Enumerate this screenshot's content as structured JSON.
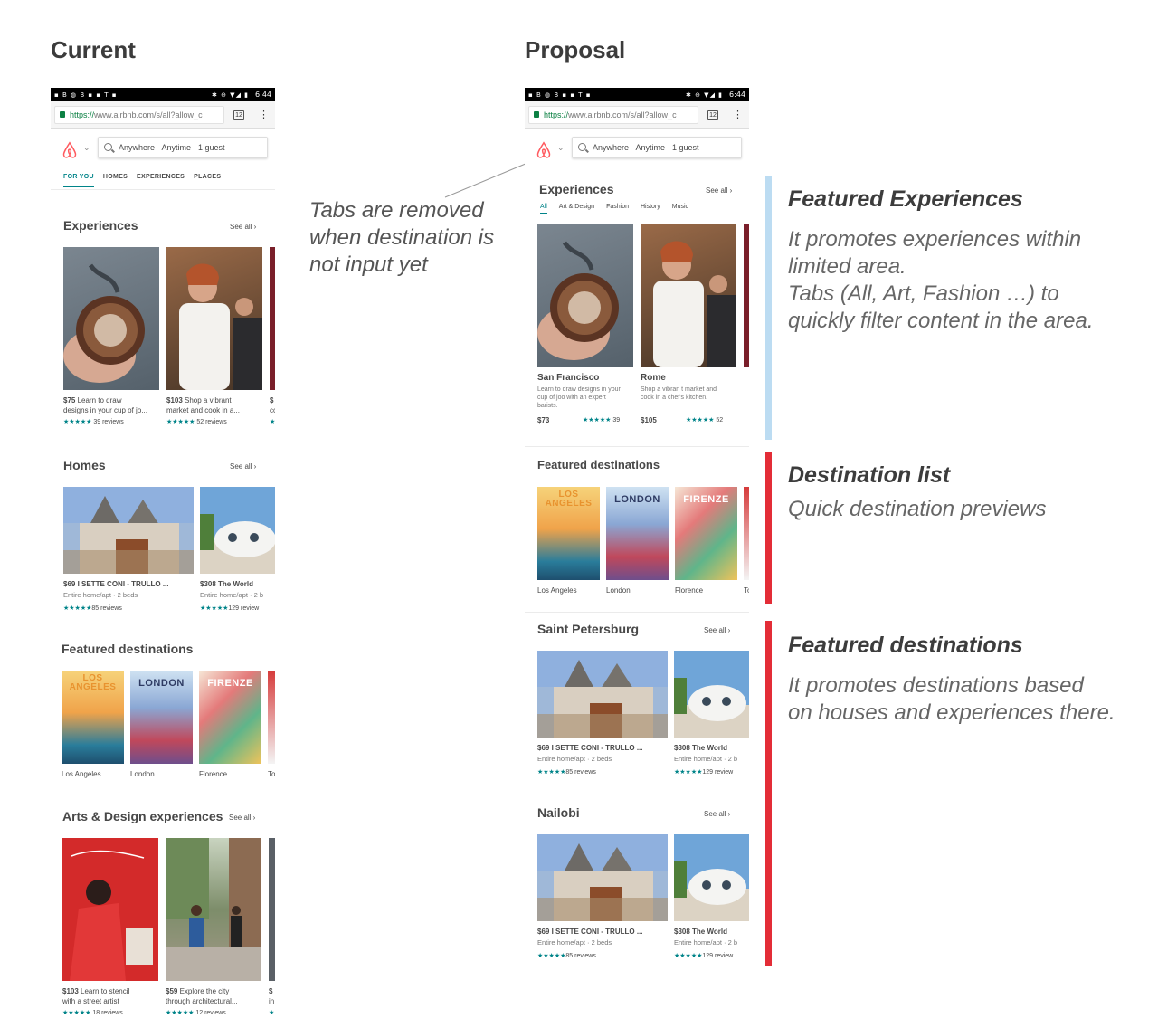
{
  "headings": {
    "current": "Current",
    "proposal": "Proposal"
  },
  "phone": {
    "time": "6:44",
    "status_icons": "▪ B ◍ B ▪ ▪ T ▪",
    "status_right": "✱ ⊖ ▼◢ ▮",
    "url_scheme": "https://",
    "url_rest": "www.airbnb.com/s/all?allow_c",
    "tab_count": "12",
    "menu_icon": "⋮",
    "chevron": "⌄",
    "search_text": "Anywhere · Anytime · 1 guest"
  },
  "current": {
    "tabs": [
      "FOR YOU",
      "HOMES",
      "EXPERIENCES",
      "PLACES"
    ],
    "experiences": {
      "title": "Experiences",
      "see_all": "See all ›",
      "cards": [
        {
          "price": "$75",
          "line1": " Learn to draw",
          "line2": "designs in your cup of jo...",
          "stars": "★★★★★",
          "reviews": "39 reviews"
        },
        {
          "price": "$103",
          "line1": " Shop a vibrant",
          "line2": "market and cook in a...",
          "stars": "★★★★★",
          "reviews": "52 reviews"
        },
        {
          "price": "$",
          "line1": "",
          "line2": "cc",
          "stars": "★",
          "reviews": ""
        }
      ]
    },
    "homes": {
      "title": "Homes",
      "see_all": "See all ›",
      "cards": [
        {
          "price": "$69",
          "name": "I SETTE CONI - TRULLO ...",
          "line2": "Entire home/apt · 2 beds",
          "stars": "★★★★★",
          "reviews": "85 reviews"
        },
        {
          "price": "$308",
          "name": "The World",
          "line2": "Entire home/apt · 2 b",
          "stars": "★★★★★",
          "reviews": "129 review"
        }
      ]
    },
    "destinations": {
      "title": "Featured destinations",
      "items": [
        "Los Angeles",
        "London",
        "Florence",
        "To"
      ]
    },
    "arts": {
      "title": "Arts & Design experiences",
      "see_all": "See all ›",
      "cards": [
        {
          "price": "$103",
          "line1": " Learn to stencil",
          "line2": "with a street artist",
          "stars": "★★★★★",
          "reviews": "18 reviews"
        },
        {
          "price": "$59",
          "line1": " Explore the city",
          "line2": "through architectural...",
          "stars": "★★★★★",
          "reviews": "12 reviews"
        },
        {
          "price": "$",
          "line1": "",
          "line2": "in",
          "stars": "★",
          "reviews": ""
        }
      ]
    }
  },
  "proposal": {
    "experiences": {
      "title": "Experiences",
      "see_all": "See all ›",
      "tabs": [
        "All",
        "Art & Design",
        "Fashion",
        "History",
        "Music"
      ],
      "cards": [
        {
          "city": "San Francisco",
          "desc1": "Learn to draw designs in your",
          "desc2": "cup of joo with an expert",
          "desc3": "barists.",
          "price": "$73",
          "stars": "★★★★★",
          "reviews": "39"
        },
        {
          "city": "Rome",
          "desc1": "Shop a vibran t market and",
          "desc2": "cook in a chef's kitchen.",
          "desc3": "",
          "price": "$105",
          "stars": "★★★★★",
          "reviews": "52"
        }
      ]
    },
    "destinations": {
      "title": "Featured destinations",
      "items": [
        "Los Angeles",
        "London",
        "Florence",
        "To"
      ]
    },
    "city1": {
      "title": "Saint Petersburg",
      "see_all": "See all ›",
      "cards": [
        {
          "price": "$69",
          "name": "I SETTE CONI - TRULLO ...",
          "line2": "Entire home/apt · 2 beds",
          "stars": "★★★★★",
          "reviews": "85 reviews"
        },
        {
          "price": "$308",
          "name": "The World",
          "line2": "Entire home/apt · 2 b",
          "stars": "★★★★★",
          "reviews": "129 review"
        }
      ]
    },
    "city2": {
      "title": "Nailobi",
      "see_all": "See all ›",
      "cards": [
        {
          "price": "$69",
          "name": "I SETTE CONI - TRULLO ...",
          "line2": "Entire home/apt · 2 beds",
          "stars": "★★★★★",
          "reviews": "85 reviews"
        },
        {
          "price": "$308",
          "name": "The World",
          "line2": "Entire home/apt · 2 b",
          "stars": "★★★★★",
          "reviews": "129 review"
        }
      ]
    }
  },
  "posters": {
    "la": "LOS ANGELES",
    "london": "LONDON",
    "firenze": "FIRENZE"
  },
  "annotations": {
    "tabs_note": [
      "Tabs are removed",
      "when destination is",
      "not input yet"
    ],
    "featured_exp": {
      "title": "Featured Experiences",
      "body": [
        "It promotes experiences within",
        "limited area.",
        "Tabs (All, Art, Fashion …) to",
        "quickly filter content in the area."
      ]
    },
    "dest_list": {
      "title": "Destination list",
      "body": [
        "Quick destination previews"
      ]
    },
    "featured_dest": {
      "title": "Featured destinations",
      "body": [
        "It promotes destinations based",
        "on houses and experiences there."
      ]
    }
  },
  "colors": {
    "accent_teal": "#008489",
    "brand_red": "#ff5a5f",
    "bar_blue": "#bcdcf2",
    "bar_red": "#e32d37"
  }
}
